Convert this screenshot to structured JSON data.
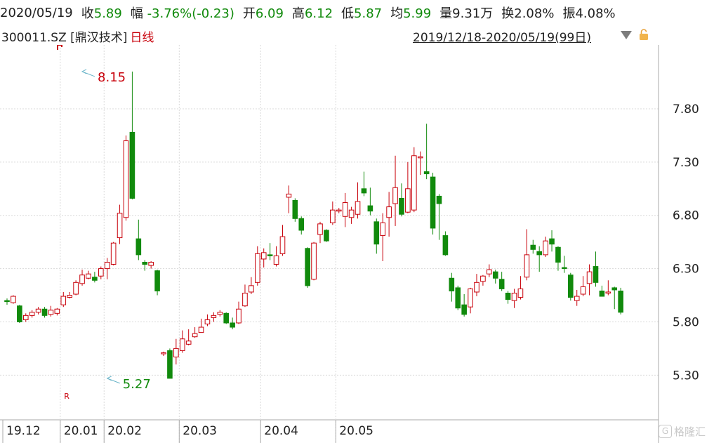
{
  "header": {
    "date": "2020/05/19",
    "close_label": "收",
    "close_value": "5.89",
    "change_label": "幅",
    "change_value": "-3.76%(-0.23)",
    "open_label": "开",
    "open_value": "6.09",
    "high_label": "高",
    "high_value": "6.12",
    "low_label": "低",
    "low_value": "5.87",
    "avg_label": "均",
    "avg_value": "5.99",
    "volume_label": "量",
    "volume_value": "9.31万",
    "turnover_label": "换",
    "turnover_value": "2.08%",
    "amplitude_label": "振",
    "amplitude_value": "4.08%"
  },
  "subheader": {
    "code": "300011.SZ [鼎汉技术]",
    "period": "日线",
    "range": "2019/12/18-2020/05/19(99日)"
  },
  "watermark": "格隆汇",
  "colors": {
    "up": "#c8000a",
    "down": "#118a0c",
    "grid": "#d9d9d9",
    "axis": "#aaaaaa"
  },
  "chart_data": {
    "type": "candlestick",
    "ylim": [
      4.9,
      8.4
    ],
    "y_ticks": [
      "7.80",
      "7.30",
      "6.80",
      "6.30",
      "5.80",
      "5.30"
    ],
    "x_labels": [
      "19.12",
      "20.01",
      "20.02",
      "20.03",
      "20.04",
      "20.05"
    ],
    "x_label_index": [
      0,
      9,
      16,
      28,
      41,
      53
    ],
    "annotations": [
      {
        "text": "8.15",
        "index": 12,
        "value": 8.15,
        "kind": "high"
      },
      {
        "text": "5.27",
        "index": 16,
        "value": 5.27,
        "kind": "low"
      }
    ],
    "markers": [
      {
        "text": "R",
        "index": 9
      }
    ],
    "candles": [
      [
        6.0,
        5.99,
        6.02,
        5.96
      ],
      [
        5.98,
        6.04,
        6.05,
        5.97
      ],
      [
        5.95,
        5.8,
        5.96,
        5.79
      ],
      [
        5.82,
        5.86,
        5.88,
        5.8
      ],
      [
        5.86,
        5.89,
        5.91,
        5.84
      ],
      [
        5.89,
        5.92,
        5.94,
        5.87
      ],
      [
        5.92,
        5.86,
        5.94,
        5.84
      ],
      [
        5.87,
        5.91,
        5.95,
        5.85
      ],
      [
        5.88,
        5.92,
        5.93,
        5.86
      ],
      [
        5.96,
        6.04,
        6.08,
        5.94
      ],
      [
        6.03,
        6.05,
        6.08,
        6.02
      ],
      [
        6.06,
        6.17,
        6.19,
        6.05
      ],
      [
        6.16,
        6.24,
        6.29,
        6.14
      ],
      [
        6.21,
        6.25,
        6.28,
        6.2
      ],
      [
        6.22,
        6.19,
        6.27,
        6.17
      ],
      [
        6.23,
        6.3,
        6.32,
        6.2
      ],
      [
        6.3,
        6.36,
        6.4,
        6.2
      ],
      [
        6.34,
        6.54,
        6.55,
        6.33
      ],
      [
        6.59,
        6.82,
        6.9,
        6.53
      ],
      [
        6.78,
        7.5,
        7.55,
        6.75
      ],
      [
        7.58,
        6.96,
        8.15,
        6.95
      ],
      [
        6.58,
        6.43,
        6.76,
        6.38
      ],
      [
        6.36,
        6.34,
        6.38,
        6.28
      ],
      [
        6.33,
        6.36,
        6.37,
        6.3
      ],
      [
        6.28,
        6.09,
        6.29,
        6.05
      ],
      [
        5.5,
        5.51,
        5.52,
        5.48
      ],
      [
        5.53,
        5.27,
        5.55,
        5.27
      ],
      [
        5.47,
        5.55,
        5.64,
        5.4
      ],
      [
        5.53,
        5.64,
        5.72,
        5.51
      ],
      [
        5.59,
        5.62,
        5.73,
        5.58
      ],
      [
        5.66,
        5.69,
        5.75,
        5.65
      ],
      [
        5.7,
        5.75,
        5.83,
        5.7
      ],
      [
        5.78,
        5.82,
        5.87,
        5.76
      ],
      [
        5.84,
        5.86,
        5.89,
        5.8
      ],
      [
        5.87,
        5.89,
        5.91,
        5.85
      ],
      [
        5.88,
        5.79,
        5.89,
        5.78
      ],
      [
        5.79,
        5.75,
        5.84,
        5.73
      ],
      [
        5.79,
        5.92,
        5.99,
        5.78
      ],
      [
        5.95,
        6.07,
        6.15,
        5.94
      ],
      [
        6.08,
        6.14,
        6.22,
        6.06
      ],
      [
        6.17,
        6.44,
        6.51,
        6.14
      ],
      [
        6.39,
        6.45,
        6.49,
        6.31
      ],
      [
        6.43,
        6.42,
        6.54,
        6.38
      ],
      [
        6.34,
        6.42,
        6.51,
        6.32
      ],
      [
        6.44,
        6.6,
        6.71,
        6.42
      ],
      [
        6.97,
        7.0,
        7.08,
        6.82
      ],
      [
        6.94,
        6.77,
        6.96,
        6.74
      ],
      [
        6.77,
        6.66,
        6.79,
        6.62
      ],
      [
        6.49,
        6.14,
        6.5,
        6.12
      ],
      [
        6.2,
        6.54,
        6.55,
        6.19
      ],
      [
        6.62,
        6.72,
        6.74,
        6.54
      ],
      [
        6.66,
        6.56,
        6.67,
        6.55
      ],
      [
        6.73,
        6.85,
        6.93,
        6.71
      ],
      [
        6.84,
        6.85,
        6.87,
        6.82
      ],
      [
        6.79,
        6.92,
        7.01,
        6.69
      ],
      [
        6.78,
        6.85,
        6.88,
        6.72
      ],
      [
        6.81,
        6.93,
        7.11,
        6.77
      ],
      [
        7.05,
        7.01,
        7.21,
        6.98
      ],
      [
        6.89,
        6.84,
        7.06,
        6.8
      ],
      [
        6.74,
        6.53,
        6.77,
        6.44
      ],
      [
        6.61,
        6.73,
        6.82,
        6.37
      ],
      [
        6.78,
        6.88,
        7.02,
        6.6
      ],
      [
        6.91,
        7.06,
        7.36,
        6.7
      ],
      [
        6.96,
        6.81,
        7.1,
        6.79
      ],
      [
        6.83,
        7.05,
        7.3,
        6.82
      ],
      [
        6.85,
        7.36,
        7.44,
        6.83
      ],
      [
        7.34,
        7.35,
        7.4,
        7.18
      ],
      [
        7.21,
        7.19,
        7.66,
        7.14
      ],
      [
        7.16,
        6.68,
        7.2,
        6.62
      ],
      [
        6.98,
        6.91,
        7.0,
        6.57
      ],
      [
        6.61,
        6.43,
        6.65,
        6.42
      ],
      [
        6.21,
        6.09,
        6.26,
        5.99
      ],
      [
        6.12,
        5.93,
        6.14,
        5.91
      ],
      [
        5.96,
        5.87,
        6.06,
        5.85
      ],
      [
        5.94,
        6.11,
        6.12,
        5.88
      ],
      [
        6.08,
        6.17,
        6.25,
        6.04
      ],
      [
        6.18,
        6.23,
        6.24,
        6.14
      ],
      [
        6.25,
        6.29,
        6.34,
        6.22
      ],
      [
        6.27,
        6.21,
        6.29,
        6.16
      ],
      [
        6.2,
        6.11,
        6.27,
        6.09
      ],
      [
        6.07,
        6.01,
        6.09,
        5.97
      ],
      [
        6.0,
        6.07,
        6.11,
        5.93
      ],
      [
        6.03,
        6.11,
        6.23,
        6.01
      ],
      [
        6.22,
        6.43,
        6.67,
        6.19
      ],
      [
        6.52,
        6.48,
        6.57,
        6.44
      ],
      [
        6.46,
        6.43,
        6.51,
        6.27
      ],
      [
        6.43,
        6.56,
        6.6,
        6.41
      ],
      [
        6.58,
        6.53,
        6.66,
        6.46
      ],
      [
        6.5,
        6.36,
        6.51,
        6.28
      ],
      [
        6.31,
        6.3,
        6.42,
        6.26
      ],
      [
        6.24,
        6.03,
        6.26,
        6.0
      ],
      [
        6.0,
        6.04,
        6.1,
        5.95
      ],
      [
        6.06,
        6.13,
        6.23,
        6.04
      ],
      [
        6.16,
        6.27,
        6.34,
        6.05
      ],
      [
        6.32,
        6.17,
        6.46,
        6.13
      ],
      [
        6.09,
        6.04,
        6.14,
        6.04
      ],
      [
        6.07,
        6.08,
        6.19,
        6.05
      ],
      [
        6.12,
        6.1,
        6.13,
        5.92
      ],
      [
        6.09,
        5.89,
        6.12,
        5.87
      ]
    ]
  }
}
